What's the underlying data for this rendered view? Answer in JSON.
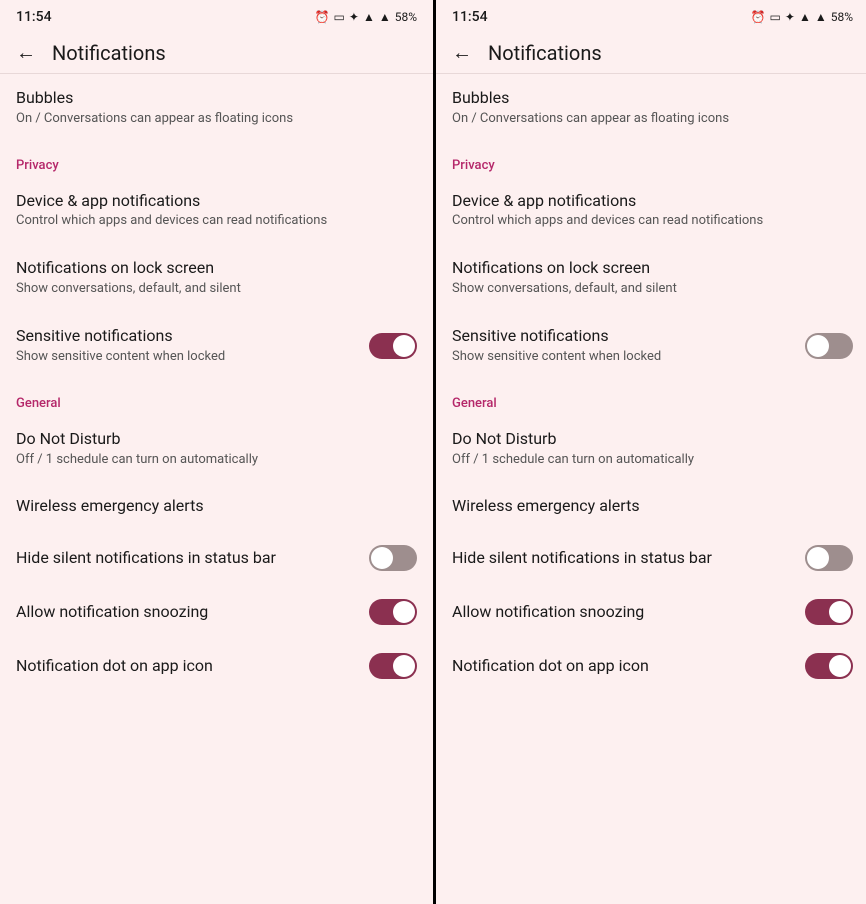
{
  "panels": [
    {
      "id": "panel-left",
      "statusBar": {
        "time": "11:54",
        "battery": "58%"
      },
      "header": {
        "backLabel": "←",
        "title": "Notifications"
      },
      "content": {
        "bubbles": {
          "title": "Bubbles",
          "subtitle": "On / Conversations can appear as floating icons"
        },
        "privacyHeader": "Privacy",
        "deviceNotifications": {
          "title": "Device & app notifications",
          "subtitle": "Control which apps and devices can read notifications"
        },
        "lockScreen": {
          "title": "Notifications on lock screen",
          "subtitle": "Show conversations, default, and silent"
        },
        "sensitiveNotifications": {
          "title": "Sensitive notifications",
          "subtitle": "Show sensitive content when locked",
          "toggleOn": true
        },
        "generalHeader": "General",
        "doNotDisturb": {
          "title": "Do Not Disturb",
          "subtitle": "Off / 1 schedule can turn on automatically"
        },
        "wirelessAlerts": {
          "title": "Wireless emergency alerts"
        },
        "hideSilent": {
          "title": "Hide silent notifications in status bar",
          "toggleOn": false
        },
        "allowSnoozing": {
          "title": "Allow notification snoozing",
          "toggleOn": true
        },
        "notificationDot": {
          "title": "Notification dot on app icon",
          "toggleOn": true
        }
      }
    },
    {
      "id": "panel-right",
      "statusBar": {
        "time": "11:54",
        "battery": "58%"
      },
      "header": {
        "backLabel": "←",
        "title": "Notifications"
      },
      "content": {
        "bubbles": {
          "title": "Bubbles",
          "subtitle": "On / Conversations can appear as floating icons"
        },
        "privacyHeader": "Privacy",
        "deviceNotifications": {
          "title": "Device & app notifications",
          "subtitle": "Control which apps and devices can read notifications"
        },
        "lockScreen": {
          "title": "Notifications on lock screen",
          "subtitle": "Show conversations, default, and silent"
        },
        "sensitiveNotifications": {
          "title": "Sensitive notifications",
          "subtitle": "Show sensitive content when locked",
          "toggleOn": false
        },
        "generalHeader": "General",
        "doNotDisturb": {
          "title": "Do Not Disturb",
          "subtitle": "Off / 1 schedule can turn on automatically"
        },
        "wirelessAlerts": {
          "title": "Wireless emergency alerts"
        },
        "hideSilent": {
          "title": "Hide silent notifications in status bar",
          "toggleOn": false
        },
        "allowSnoozing": {
          "title": "Allow notification snoozing",
          "toggleOn": true
        },
        "notificationDot": {
          "title": "Notification dot on app icon",
          "toggleOn": true
        }
      }
    }
  ],
  "colors": {
    "accent": "#b5286a",
    "toggleOn": "#8b3050",
    "toggleOff": "#9e8e8e",
    "background": "#fdf0f0"
  }
}
